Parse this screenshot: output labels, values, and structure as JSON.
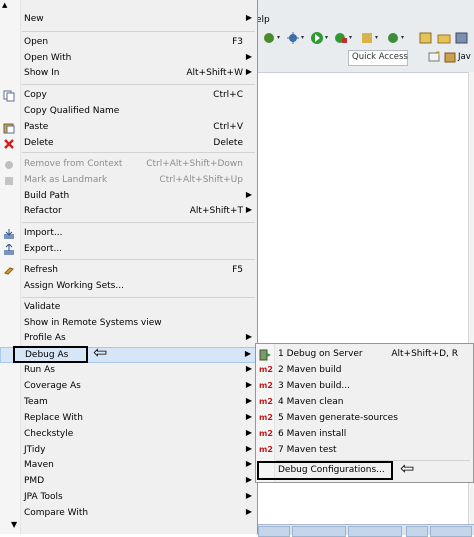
{
  "background": {
    "menubar_fragment": "elp",
    "quick_access_label": "Quick Access",
    "perspective_label": "Jav"
  },
  "context_menu": {
    "items": [
      {
        "label": "New",
        "shortcut": "",
        "submenu": true,
        "disabled": false,
        "icon": ""
      },
      {
        "label": "Open",
        "shortcut": "F3",
        "submenu": false,
        "disabled": false,
        "icon": ""
      },
      {
        "label": "Open With",
        "shortcut": "",
        "submenu": true,
        "disabled": false,
        "icon": ""
      },
      {
        "label": "Show In",
        "shortcut": "Alt+Shift+W",
        "submenu": true,
        "disabled": false,
        "icon": ""
      },
      {
        "label": "Copy",
        "shortcut": "Ctrl+C",
        "submenu": false,
        "disabled": false,
        "icon": "copy-icon"
      },
      {
        "label": "Copy Qualified Name",
        "shortcut": "",
        "submenu": false,
        "disabled": false,
        "icon": ""
      },
      {
        "label": "Paste",
        "shortcut": "Ctrl+V",
        "submenu": false,
        "disabled": false,
        "icon": "paste-icon"
      },
      {
        "label": "Delete",
        "shortcut": "Delete",
        "submenu": false,
        "disabled": false,
        "icon": "delete-icon"
      },
      {
        "label": "Remove from Context",
        "shortcut": "Ctrl+Alt+Shift+Down",
        "submenu": false,
        "disabled": true,
        "icon": "remove-context-icon"
      },
      {
        "label": "Mark as Landmark",
        "shortcut": "Ctrl+Alt+Shift+Up",
        "submenu": false,
        "disabled": true,
        "icon": "landmark-icon"
      },
      {
        "label": "Build Path",
        "shortcut": "",
        "submenu": true,
        "disabled": false,
        "icon": ""
      },
      {
        "label": "Refactor",
        "shortcut": "Alt+Shift+T",
        "submenu": true,
        "disabled": false,
        "icon": ""
      },
      {
        "label": "Import...",
        "shortcut": "",
        "submenu": false,
        "disabled": false,
        "icon": "import-icon"
      },
      {
        "label": "Export...",
        "shortcut": "",
        "submenu": false,
        "disabled": false,
        "icon": "export-icon"
      },
      {
        "label": "Refresh",
        "shortcut": "F5",
        "submenu": false,
        "disabled": false,
        "icon": "refresh-icon"
      },
      {
        "label": "Assign Working Sets...",
        "shortcut": "",
        "submenu": false,
        "disabled": false,
        "icon": ""
      },
      {
        "label": "Validate",
        "shortcut": "",
        "submenu": false,
        "disabled": false,
        "icon": ""
      },
      {
        "label": "Show in Remote Systems view",
        "shortcut": "",
        "submenu": false,
        "disabled": false,
        "icon": ""
      },
      {
        "label": "Profile As",
        "shortcut": "",
        "submenu": true,
        "disabled": false,
        "icon": ""
      },
      {
        "label": "Debug As",
        "shortcut": "",
        "submenu": true,
        "disabled": false,
        "icon": ""
      },
      {
        "label": "Run As",
        "shortcut": "",
        "submenu": true,
        "disabled": false,
        "icon": ""
      },
      {
        "label": "Coverage As",
        "shortcut": "",
        "submenu": true,
        "disabled": false,
        "icon": ""
      },
      {
        "label": "Team",
        "shortcut": "",
        "submenu": true,
        "disabled": false,
        "icon": ""
      },
      {
        "label": "Replace With",
        "shortcut": "",
        "submenu": true,
        "disabled": false,
        "icon": ""
      },
      {
        "label": "Checkstyle",
        "shortcut": "",
        "submenu": true,
        "disabled": false,
        "icon": ""
      },
      {
        "label": "JTidy",
        "shortcut": "",
        "submenu": true,
        "disabled": false,
        "icon": ""
      },
      {
        "label": "Maven",
        "shortcut": "",
        "submenu": true,
        "disabled": false,
        "icon": ""
      },
      {
        "label": "PMD",
        "shortcut": "",
        "submenu": true,
        "disabled": false,
        "icon": ""
      },
      {
        "label": "JPA Tools",
        "shortcut": "",
        "submenu": true,
        "disabled": false,
        "icon": ""
      },
      {
        "label": "Compare With",
        "shortcut": "",
        "submenu": true,
        "disabled": false,
        "icon": ""
      }
    ],
    "scroll_arrow": "▼",
    "submenu_arrow": "▶"
  },
  "debug_submenu": {
    "items": [
      {
        "label": "1 Debug on Server",
        "shortcut": "Alt+Shift+D, R",
        "icon": "server-debug-icon"
      },
      {
        "label": "2 Maven build",
        "shortcut": "",
        "icon": "m2"
      },
      {
        "label": "3 Maven build...",
        "shortcut": "",
        "icon": "m2"
      },
      {
        "label": "4 Maven clean",
        "shortcut": "",
        "icon": "m2"
      },
      {
        "label": "5 Maven generate-sources",
        "shortcut": "",
        "icon": "m2"
      },
      {
        "label": "6 Maven install",
        "shortcut": "",
        "icon": "m2"
      },
      {
        "label": "7 Maven test",
        "shortcut": "",
        "icon": "m2"
      },
      {
        "label": "Debug Configurations...",
        "shortcut": "",
        "icon": ""
      }
    ]
  },
  "annotations": {
    "arrow_glyph": "⇦"
  },
  "colors": {
    "menu_bg": "#f0f0f0",
    "highlight": "#d7e6f7",
    "m2_red": "#c01b1b",
    "delete_red": "#d42020"
  }
}
